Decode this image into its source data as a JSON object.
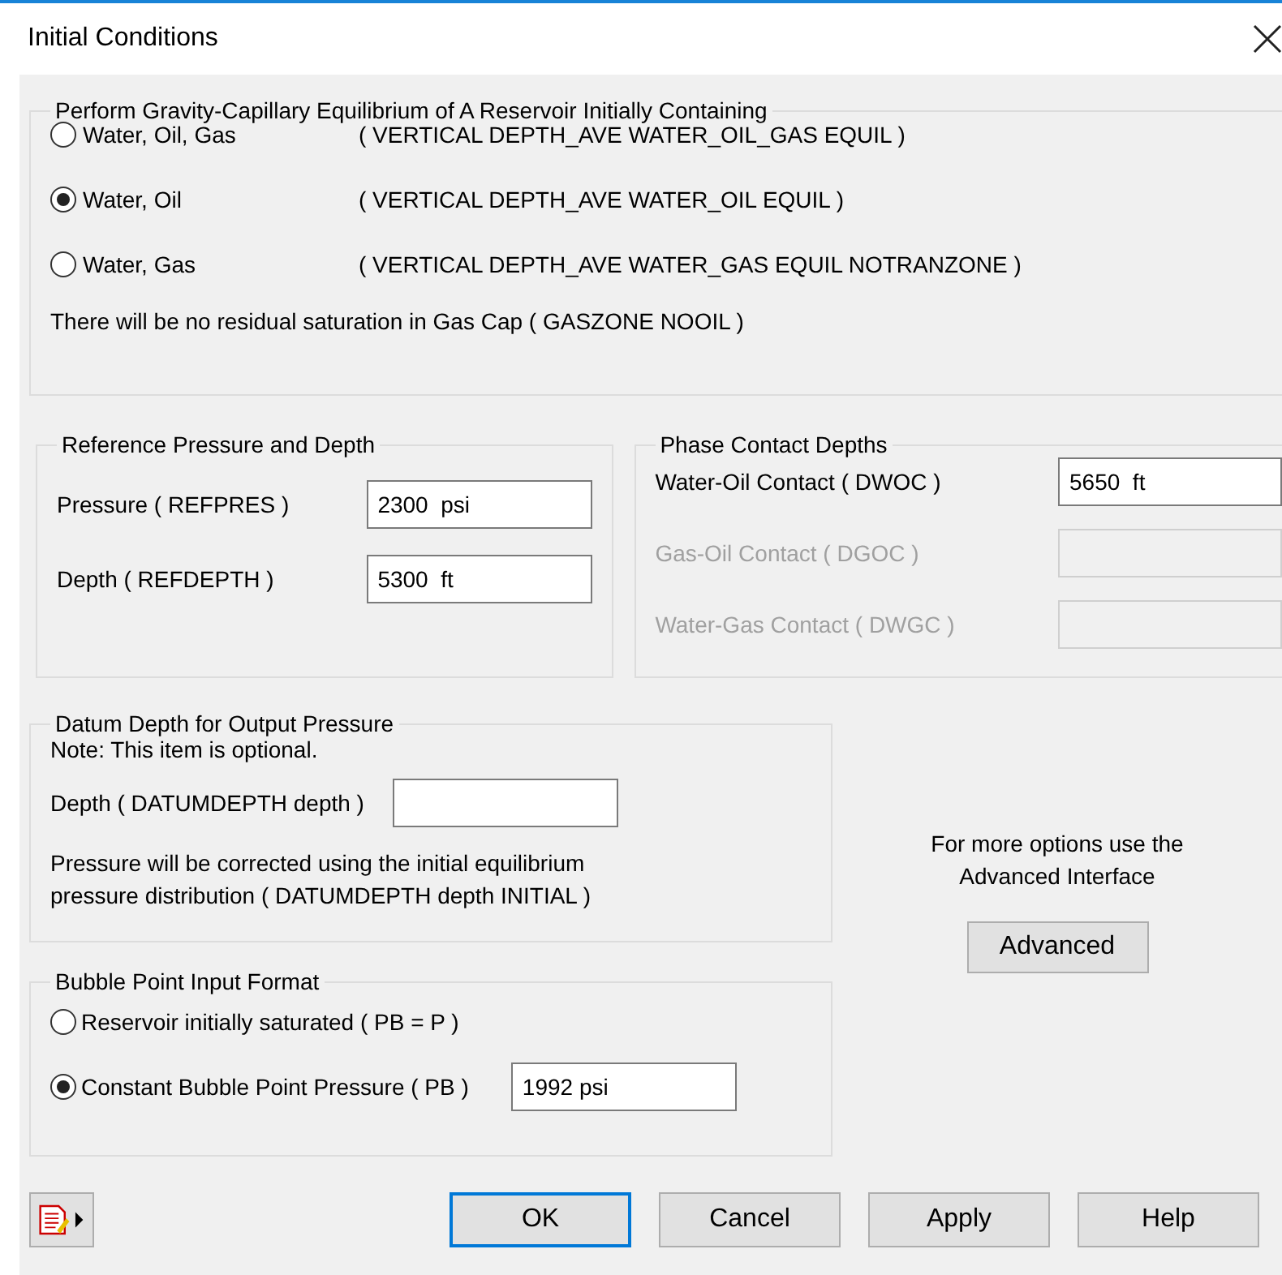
{
  "window": {
    "title": "Initial Conditions"
  },
  "equilibrium": {
    "legend": "Perform Gravity-Capillary Equilibrium of A Reservoir Initially Containing",
    "options": [
      {
        "label": "Water, Oil, Gas",
        "keyword": "( VERTICAL DEPTH_AVE WATER_OIL_GAS EQUIL )",
        "selected": false
      },
      {
        "label": "Water, Oil",
        "keyword": "( VERTICAL DEPTH_AVE WATER_OIL EQUIL )",
        "selected": true
      },
      {
        "label": "Water, Gas",
        "keyword": "( VERTICAL DEPTH_AVE WATER_GAS EQUIL NOTRANZONE )",
        "selected": false
      }
    ],
    "note": "There will be no residual saturation in Gas Cap ( GASZONE NOOIL )"
  },
  "reference": {
    "legend": "Reference Pressure and Depth",
    "fields": [
      {
        "label": "Pressure ( REFPRES )",
        "value": "2300  psi"
      },
      {
        "label": "Depth ( REFDEPTH )",
        "value": "5300  ft"
      }
    ]
  },
  "contacts": {
    "legend": "Phase Contact Depths",
    "fields": [
      {
        "label": "Water-Oil Contact ( DWOC )",
        "value": "5650  ft",
        "disabled": false
      },
      {
        "label": "Gas-Oil Contact ( DGOC )",
        "disabled": true
      },
      {
        "label": "Water-Gas Contact ( DWGC )",
        "disabled": true
      }
    ]
  },
  "datum": {
    "legend": "Datum Depth for Output Pressure",
    "note": "Note: This item is optional.",
    "field_label": "Depth ( DATUMDEPTH depth )",
    "description": "Pressure will be corrected using the initial equilibrium\npressure distribution ( DATUMDEPTH depth INITIAL )"
  },
  "advanced": {
    "text": "For more options use the\nAdvanced Interface",
    "button": "Advanced"
  },
  "bubble": {
    "legend": "Bubble Point Input Format",
    "options": [
      {
        "label": "Reservoir initially saturated ( PB = P )",
        "selected": false
      },
      {
        "label": "Constant Bubble Point Pressure ( PB )",
        "selected": true,
        "value": "1992 psi"
      }
    ]
  },
  "buttons": [
    {
      "label": "OK",
      "default": true
    },
    {
      "label": "Cancel",
      "default": false
    },
    {
      "label": "Apply",
      "default": false
    },
    {
      "label": "Help",
      "default": false
    }
  ]
}
